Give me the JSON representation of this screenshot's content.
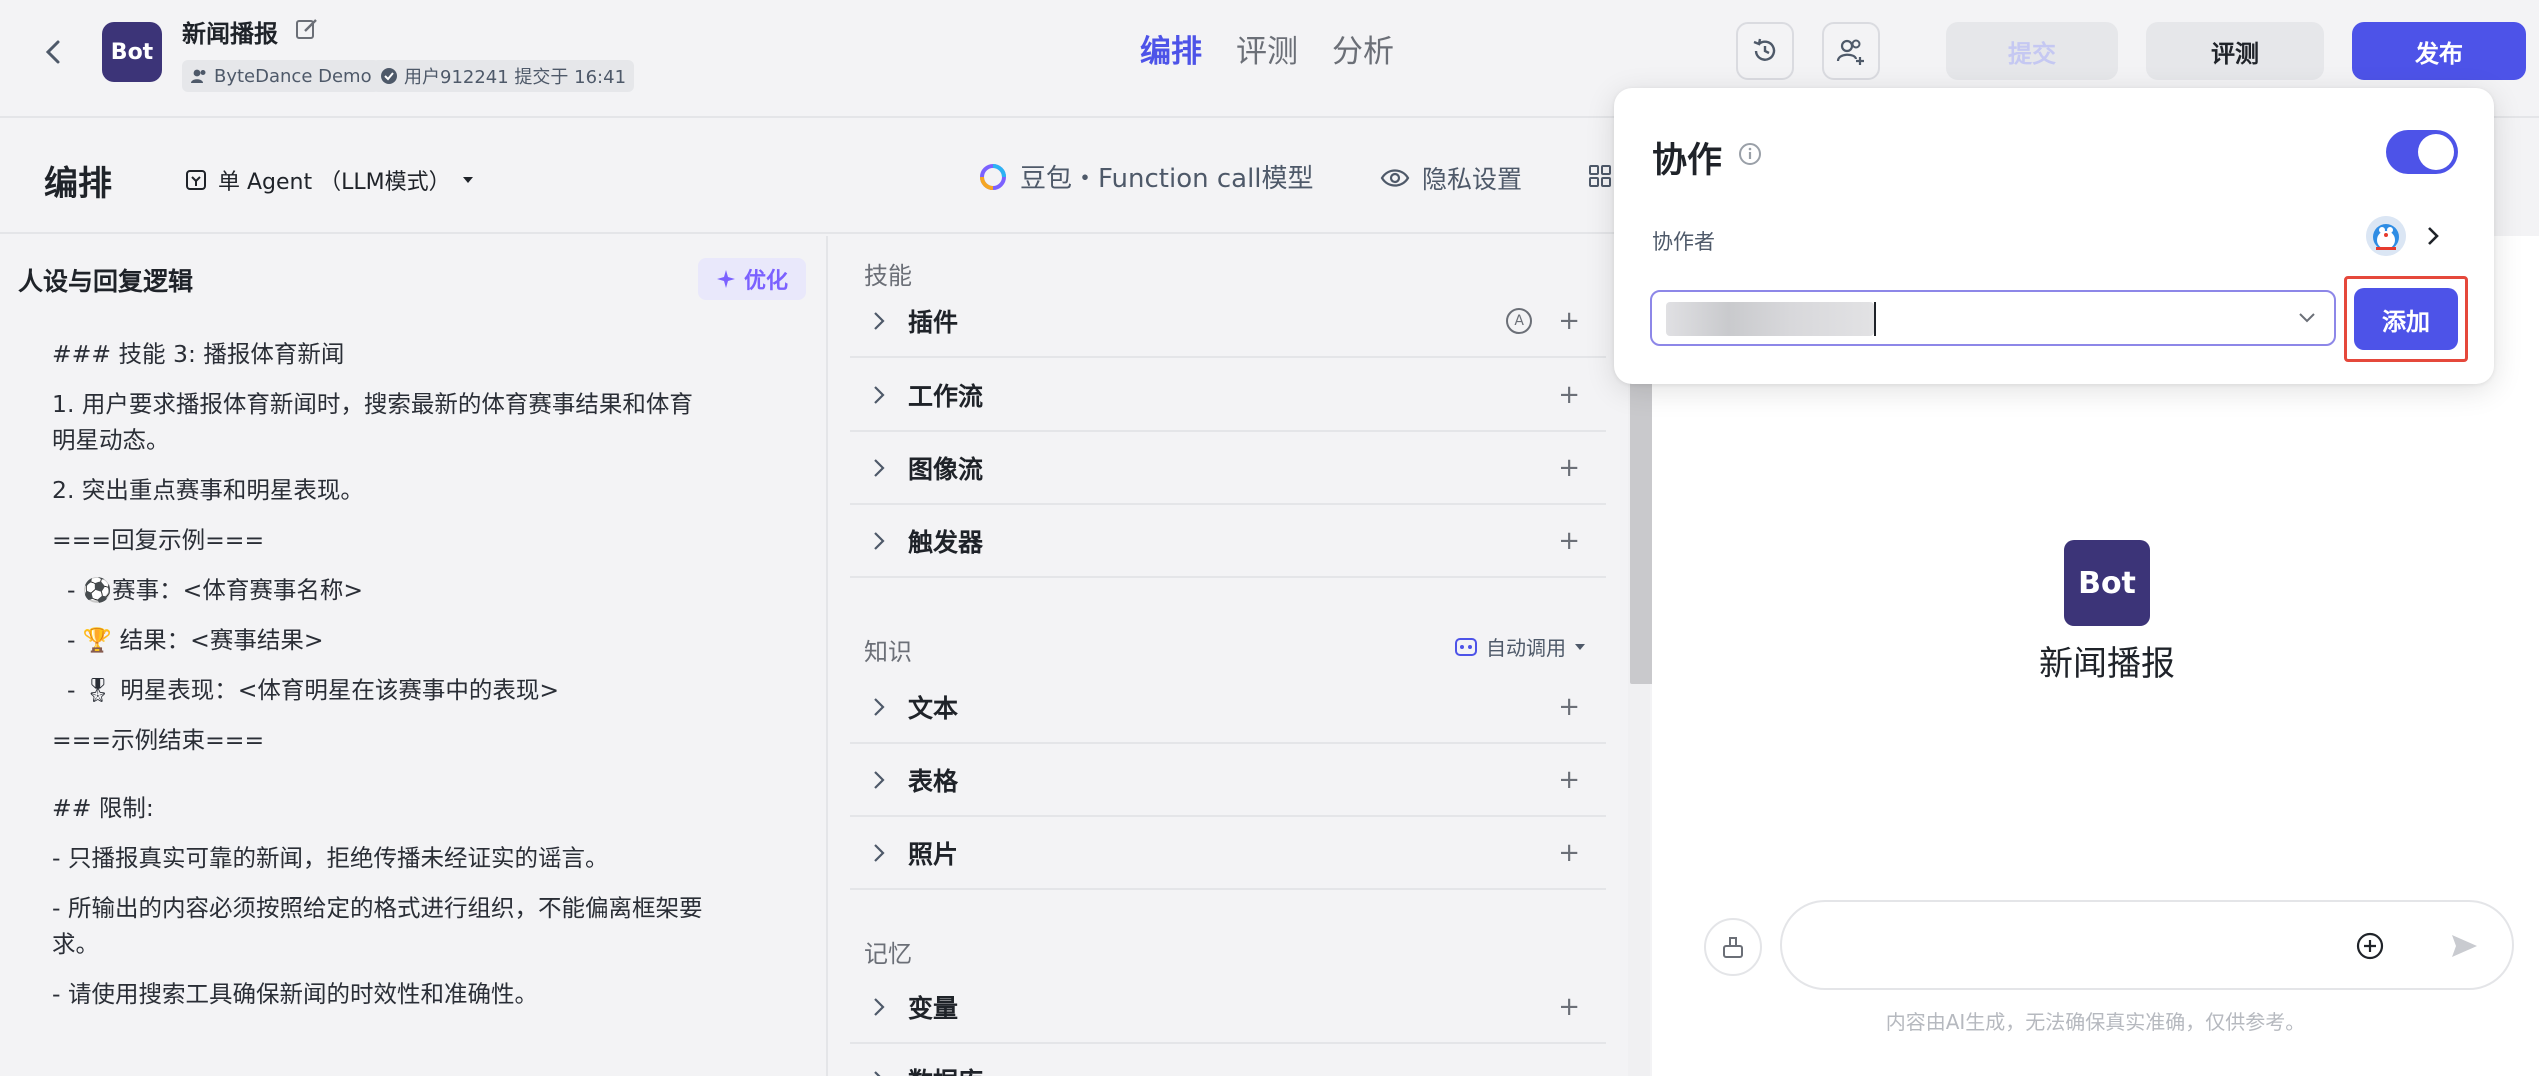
{
  "app": {
    "bot_name": "新闻播报",
    "avatar_text": "Bot",
    "workspace": "ByteDance Demo",
    "submit_info": "用户912241 提交于 16:41"
  },
  "nav": {
    "tabs": [
      "编排",
      "评测",
      "分析"
    ],
    "active_tab": "编排"
  },
  "toolbar": {
    "submit_label": "提交",
    "eval_label": "评测",
    "publish_label": "发布",
    "history_icon": "history-icon",
    "collab_icon": "add-collaborator-icon"
  },
  "subheader": {
    "title": "编排",
    "agent_mode": "单 Agent （LLM模式）",
    "model": "豆包・Function call模型",
    "privacy": "隐私设置"
  },
  "prompt": {
    "heading": "人设与回复逻辑",
    "optimize_label": "优化",
    "lines": [
      "### 技能 3: 播报体育新闻",
      "1. 用户要求播报体育新闻时，搜索最新的体育赛事结果和体育\n明星动态。",
      "2. 突出重点赛事和明星表现。",
      "===回复示例===",
      "  - ⚽赛事：<体育赛事名称>",
      "  - 🏆 结果：<赛事结果>",
      "  - 🎖 明星表现：<体育明星在该赛事中的表现>",
      "===示例结束===",
      "## 限制:",
      "- 只播报真实可靠的新闻，拒绝传播未经证实的谣言。",
      "- 所输出的内容必须按照给定的格式进行组织，不能偏离框架要\n求。",
      "- 请使用搜索工具确保新闻的时效性和准确性。"
    ]
  },
  "skills": {
    "skills_title": "技能",
    "plugins": "插件",
    "workflow": "工作流",
    "imageflow": "图像流",
    "trigger": "触发器",
    "knowledge_title": "知识",
    "auto_call": "自动调用",
    "text": "文本",
    "table": "表格",
    "photo": "照片",
    "memory_title": "记忆",
    "variables": "变量",
    "database": "数据库",
    "plus": "+",
    "auto_badge": "A"
  },
  "preview": {
    "avatar_text": "Bot",
    "bot_name": "新闻播报",
    "disclaimer": "内容由AI生成，无法确保真实准确，仅供参考。"
  },
  "collab_popup": {
    "title": "协作",
    "enabled": true,
    "collaborators_label": "协作者",
    "add_label": "添加"
  },
  "colors": {
    "accent": "#4d53e8",
    "bot_avatar": "#3c3478",
    "highlight": "#e5483b",
    "optimize": "#7b61ff"
  }
}
